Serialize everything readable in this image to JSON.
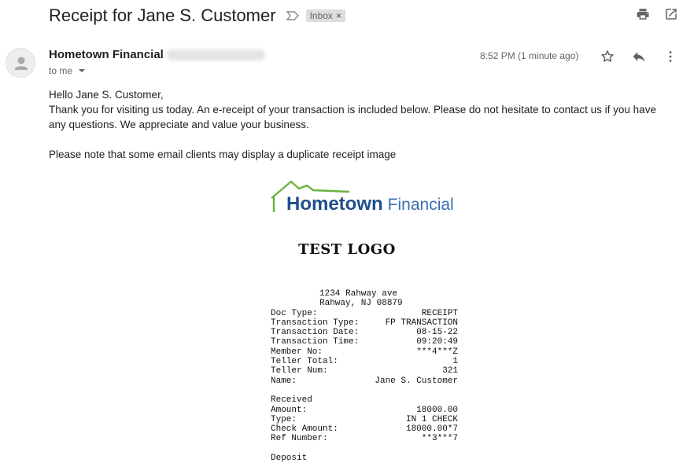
{
  "email": {
    "subject": "Receipt for Jane S. Customer",
    "label": "Inbox",
    "label_close": "×",
    "sender_name": "Hometown Financial",
    "to_me": "to me",
    "timestamp": "8:52 PM (1 minute ago)",
    "icons": {
      "importance": "importance-marker-icon",
      "print": "print-icon",
      "open_new_window": "open-in-new-window-icon",
      "star": "star-icon",
      "reply": "reply-icon",
      "more": "more-vertical-icon",
      "avatar": "person-avatar-icon"
    },
    "body": {
      "greeting": "Hello Jane S. Customer,",
      "line1": "Thank you for visiting us today. An e-receipt of your transaction is included below. Please do not hesitate to contact us if you have any questions. We appreciate and value your business.",
      "line2": "Please note that some email clients may display a duplicate receipt image"
    }
  },
  "logo": {
    "brand_primary": "Hometown",
    "brand_secondary": "Financial",
    "test_logo": "TEST LOGO",
    "colors": {
      "roof": "#6db33f",
      "primary": "#1f4e8c",
      "secondary": "#3a6fb0"
    }
  },
  "receipt": {
    "address_line1": "1234 Rahway ave",
    "address_line2": "Rahway, NJ 08879",
    "rows": [
      {
        "label": "Doc Type:",
        "value": "RECEIPT"
      },
      {
        "label": "Transaction Type:",
        "value": "FP TRANSACTION"
      },
      {
        "label": "Transaction Date:",
        "value": "08-15-22"
      },
      {
        "label": "Transaction Time:",
        "value": "09:20:49"
      },
      {
        "label": "Member No:",
        "value": "***4***Z"
      },
      {
        "label": "Teller Total:",
        "value": "1"
      },
      {
        "label": "Teller Num:",
        "value": "321"
      },
      {
        "label": "Name:",
        "value": "Jane S. Customer"
      }
    ],
    "received_heading": "Received",
    "received_rows": [
      {
        "label": "Amount:",
        "value": "18000.00"
      },
      {
        "label": "Type:",
        "value": "IN 1 CHECK"
      },
      {
        "label": "Check Amount:",
        "value": "18000.00*7"
      },
      {
        "label": "Ref Number:",
        "value": "**3***7"
      }
    ],
    "deposit_heading": "Deposit"
  }
}
